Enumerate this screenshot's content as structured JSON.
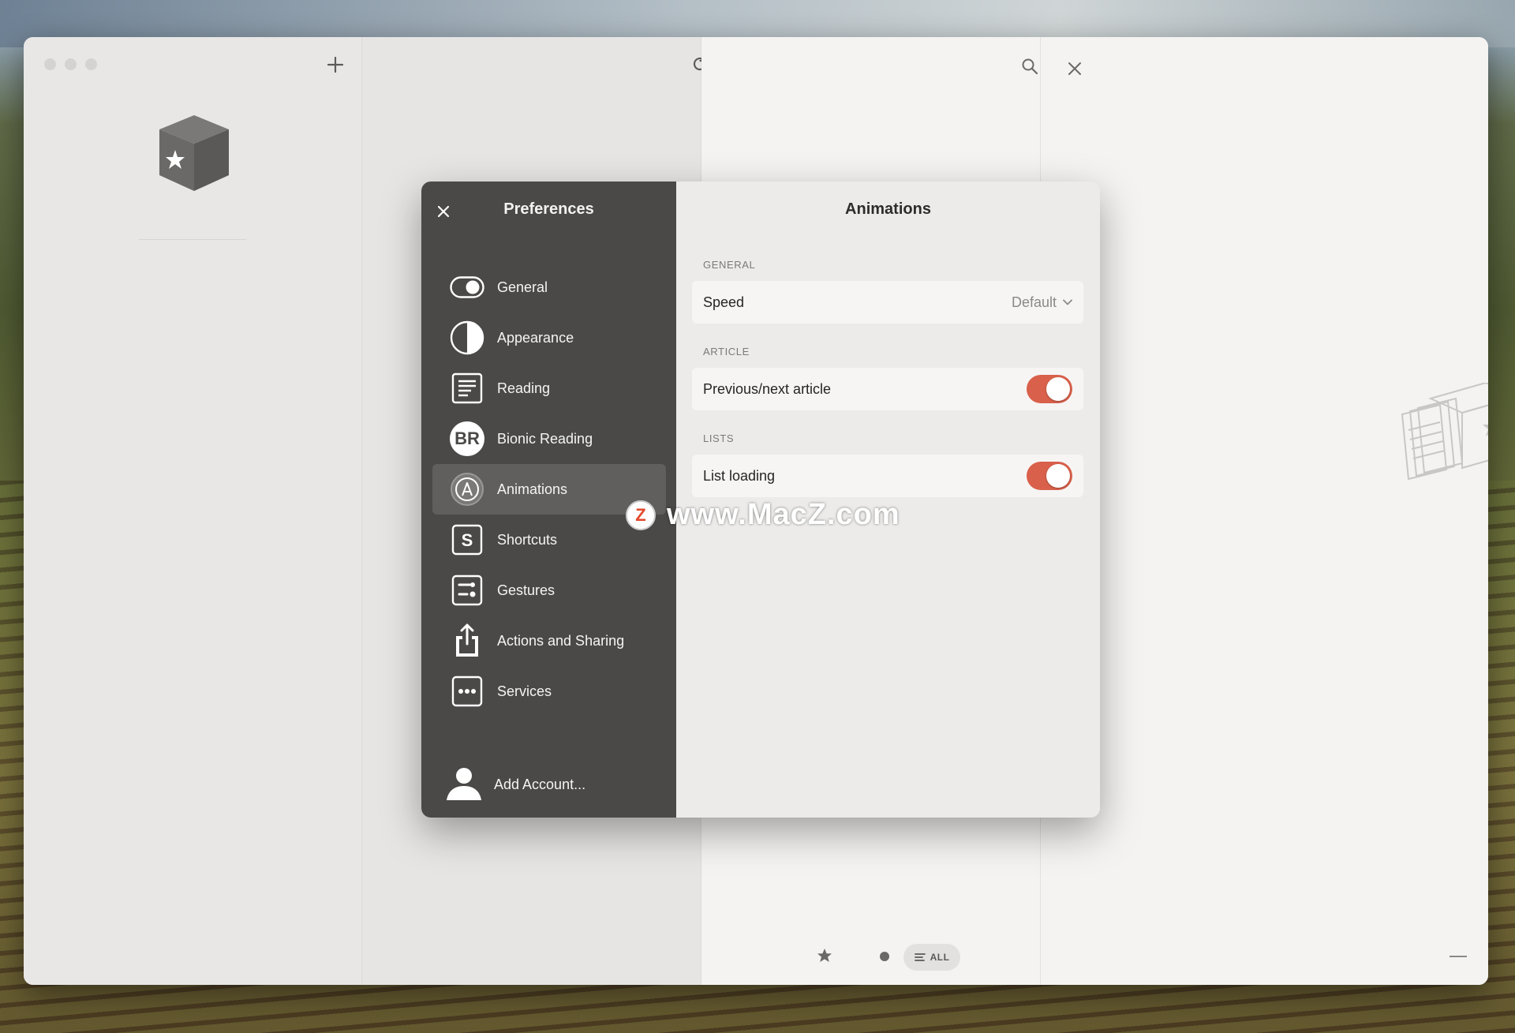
{
  "dialog": {
    "title": "Preferences",
    "close_icon": "close-icon",
    "nav": [
      {
        "label": "General",
        "icon": "toggle-icon"
      },
      {
        "label": "Appearance",
        "icon": "half-circle-icon"
      },
      {
        "label": "Reading",
        "icon": "document-lines-icon"
      },
      {
        "label": "Bionic Reading",
        "icon": "br-badge-icon",
        "badge_text": "BR"
      },
      {
        "label": "Animations",
        "icon": "letter-a-circle-icon",
        "active": true
      },
      {
        "label": "Shortcuts",
        "icon": "letter-s-square-icon"
      },
      {
        "label": "Gestures",
        "icon": "gestures-icon"
      },
      {
        "label": "Actions and Sharing",
        "icon": "share-icon"
      },
      {
        "label": "Services",
        "icon": "ellipsis-square-icon"
      }
    ],
    "add_account": "Add Account..."
  },
  "main": {
    "title": "Animations",
    "sections": [
      {
        "label": "GENERAL",
        "rows": [
          {
            "label": "Speed",
            "value": "Default"
          }
        ]
      },
      {
        "label": "ARTICLE",
        "rows": [
          {
            "label": "Previous/next article",
            "toggle": true
          }
        ]
      },
      {
        "label": "LISTS",
        "rows": [
          {
            "label": "List loading",
            "toggle": true
          }
        ]
      }
    ]
  },
  "bottom_bar": {
    "all_label": "ALL"
  },
  "watermark": {
    "badge": "Z",
    "text": "www.MacZ.com"
  },
  "colors": {
    "toggle_on": "#d9604a",
    "sidebar_bg": "#4a4947",
    "sidebar_active": "#605f5d"
  }
}
